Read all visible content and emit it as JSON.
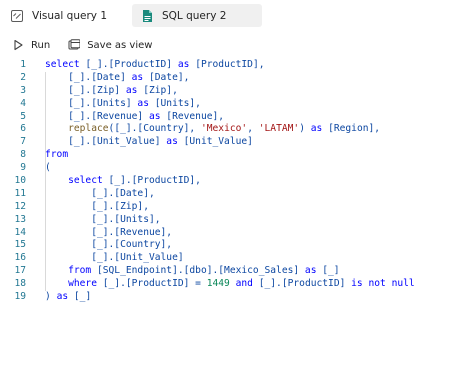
{
  "tabs": [
    {
      "label": "Visual query 1",
      "icon": "visual-query-icon"
    },
    {
      "label": "SQL query 2",
      "icon": "sql-file-icon",
      "active": true
    }
  ],
  "toolbar": {
    "run_label": "Run",
    "save_label": "Save as view"
  },
  "editor": {
    "lines": [
      {
        "n": "1",
        "tokens": [
          {
            "t": "kw",
            "v": "select "
          },
          {
            "t": "id",
            "v": "[_].[ProductID] "
          },
          {
            "t": "kw",
            "v": "as "
          },
          {
            "t": "id",
            "v": "[ProductID],"
          }
        ]
      },
      {
        "n": "2",
        "tokens": [
          {
            "t": "id",
            "v": "    [_].[Date] "
          },
          {
            "t": "kw",
            "v": "as "
          },
          {
            "t": "id",
            "v": "[Date],"
          }
        ]
      },
      {
        "n": "3",
        "tokens": [
          {
            "t": "id",
            "v": "    [_].[Zip] "
          },
          {
            "t": "kw",
            "v": "as "
          },
          {
            "t": "id",
            "v": "[Zip],"
          }
        ]
      },
      {
        "n": "4",
        "tokens": [
          {
            "t": "id",
            "v": "    [_].[Units] "
          },
          {
            "t": "kw",
            "v": "as "
          },
          {
            "t": "id",
            "v": "[Units],"
          }
        ]
      },
      {
        "n": "5",
        "tokens": [
          {
            "t": "id",
            "v": "    [_].[Revenue] "
          },
          {
            "t": "kw",
            "v": "as "
          },
          {
            "t": "id",
            "v": "[Revenue],"
          }
        ]
      },
      {
        "n": "6",
        "tokens": [
          {
            "t": "fn",
            "v": "    replace"
          },
          {
            "t": "id",
            "v": "([_].[Country], "
          },
          {
            "t": "str",
            "v": "'Mexico'"
          },
          {
            "t": "id",
            "v": ", "
          },
          {
            "t": "str",
            "v": "'LATAM'"
          },
          {
            "t": "id",
            "v": ") "
          },
          {
            "t": "kw",
            "v": "as "
          },
          {
            "t": "id",
            "v": "[Region],"
          }
        ]
      },
      {
        "n": "7",
        "tokens": [
          {
            "t": "id",
            "v": "    [_].[Unit_Value] "
          },
          {
            "t": "kw",
            "v": "as "
          },
          {
            "t": "id",
            "v": "[Unit_Value]"
          }
        ]
      },
      {
        "n": "8",
        "tokens": [
          {
            "t": "kw",
            "v": "from"
          }
        ]
      },
      {
        "n": "9",
        "tokens": [
          {
            "t": "id",
            "v": "("
          }
        ]
      },
      {
        "n": "10",
        "tokens": [
          {
            "t": "kw",
            "v": "    select "
          },
          {
            "t": "id",
            "v": "[_].[ProductID],"
          }
        ]
      },
      {
        "n": "11",
        "tokens": [
          {
            "t": "id",
            "v": "        [_].[Date],"
          }
        ]
      },
      {
        "n": "12",
        "tokens": [
          {
            "t": "id",
            "v": "        [_].[Zip],"
          }
        ]
      },
      {
        "n": "13",
        "tokens": [
          {
            "t": "id",
            "v": "        [_].[Units],"
          }
        ]
      },
      {
        "n": "14",
        "tokens": [
          {
            "t": "id",
            "v": "        [_].[Revenue],"
          }
        ]
      },
      {
        "n": "15",
        "tokens": [
          {
            "t": "id",
            "v": "        [_].[Country],"
          }
        ]
      },
      {
        "n": "16",
        "tokens": [
          {
            "t": "id",
            "v": "        [_].[Unit_Value]"
          }
        ]
      },
      {
        "n": "17",
        "tokens": [
          {
            "t": "kw",
            "v": "    from "
          },
          {
            "t": "id",
            "v": "[SQL_Endpoint].[dbo].[Mexico_Sales] "
          },
          {
            "t": "kw",
            "v": "as "
          },
          {
            "t": "id",
            "v": "[_]"
          }
        ]
      },
      {
        "n": "18",
        "tokens": [
          {
            "t": "kw",
            "v": "    where "
          },
          {
            "t": "id",
            "v": "[_].[ProductID] = "
          },
          {
            "t": "num",
            "v": "1449 "
          },
          {
            "t": "kw",
            "v": "and "
          },
          {
            "t": "id",
            "v": "[_].[ProductID] "
          },
          {
            "t": "kw",
            "v": "is not null"
          }
        ]
      },
      {
        "n": "19",
        "tokens": [
          {
            "t": "id",
            "v": ") "
          },
          {
            "t": "kw",
            "v": "as "
          },
          {
            "t": "id",
            "v": "[_]"
          }
        ]
      }
    ]
  },
  "colors": {
    "keyword": "#0000ff",
    "identifier": "#0d47a1",
    "string": "#a31515",
    "number": "#098658",
    "function": "#795e26",
    "line_number": "#237893",
    "active_tab_bg": "#f0f0f0"
  }
}
